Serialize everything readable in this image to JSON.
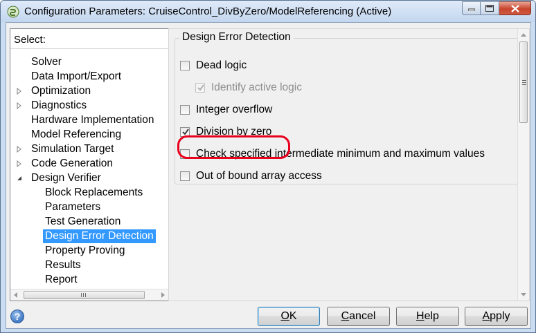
{
  "window": {
    "title": "Configuration Parameters: CruiseControl_DivByZero/ModelReferencing (Active)"
  },
  "tree": {
    "header": "Select:",
    "items": [
      {
        "label": "Solver",
        "level": 0,
        "expander": "none"
      },
      {
        "label": "Data Import/Export",
        "level": 0,
        "expander": "none"
      },
      {
        "label": "Optimization",
        "level": 0,
        "expander": "collapsed"
      },
      {
        "label": "Diagnostics",
        "level": 0,
        "expander": "collapsed"
      },
      {
        "label": "Hardware Implementation",
        "level": 0,
        "expander": "none"
      },
      {
        "label": "Model Referencing",
        "level": 0,
        "expander": "none"
      },
      {
        "label": "Simulation Target",
        "level": 0,
        "expander": "collapsed"
      },
      {
        "label": "Code Generation",
        "level": 0,
        "expander": "collapsed"
      },
      {
        "label": "Design Verifier",
        "level": 0,
        "expander": "expanded"
      },
      {
        "label": "Block Replacements",
        "level": 1,
        "expander": "none"
      },
      {
        "label": "Parameters",
        "level": 1,
        "expander": "none"
      },
      {
        "label": "Test Generation",
        "level": 1,
        "expander": "none"
      },
      {
        "label": "Design Error Detection",
        "level": 1,
        "expander": "none",
        "selected": true
      },
      {
        "label": "Property Proving",
        "level": 1,
        "expander": "none"
      },
      {
        "label": "Results",
        "level": 1,
        "expander": "none"
      },
      {
        "label": "Report",
        "level": 1,
        "expander": "none"
      }
    ]
  },
  "panel": {
    "group_title": "Design Error Detection",
    "options": [
      {
        "label": "Dead logic",
        "checked": false,
        "disabled": false,
        "indent": false
      },
      {
        "label": "Identify active logic",
        "checked": true,
        "disabled": true,
        "indent": true
      },
      {
        "label": "Integer overflow",
        "checked": false,
        "disabled": false,
        "indent": false
      },
      {
        "label": "Division by zero",
        "checked": true,
        "disabled": false,
        "indent": false,
        "highlighted": true
      },
      {
        "label": "Check specified intermediate minimum and maximum values",
        "checked": false,
        "disabled": false,
        "indent": false
      },
      {
        "label": "Out of bound array access",
        "checked": false,
        "disabled": false,
        "indent": false
      }
    ]
  },
  "buttons": {
    "ok": {
      "pre": "",
      "mnemonic": "O",
      "post": "K"
    },
    "cancel": {
      "pre": "",
      "mnemonic": "C",
      "post": "ancel"
    },
    "help": {
      "pre": "",
      "mnemonic": "H",
      "post": "elp"
    },
    "apply": {
      "pre": "",
      "mnemonic": "A",
      "post": "pply"
    }
  },
  "colors": {
    "selection": "#3399ff",
    "highlight_ring": "#e8001c"
  }
}
